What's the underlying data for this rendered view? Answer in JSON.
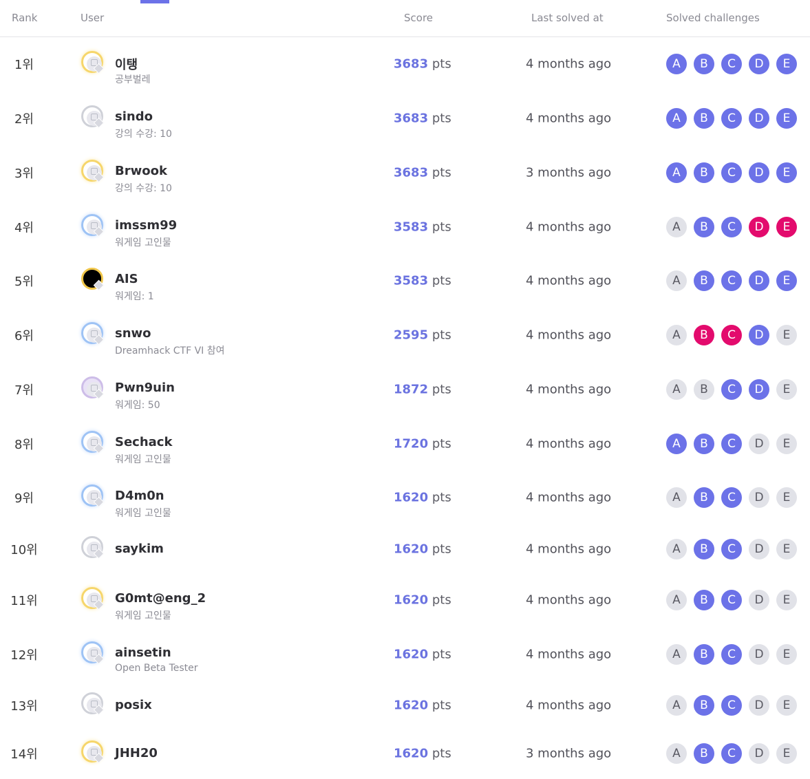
{
  "header": {
    "rank": "Rank",
    "user": "User",
    "score": "Score",
    "last_solved": "Last solved at",
    "solved": "Solved challenges"
  },
  "score_unit": "pts",
  "challenge_labels": [
    "A",
    "B",
    "C",
    "D",
    "E"
  ],
  "colors": {
    "accent": "#6c72e8",
    "first_blood": "#e30b6d",
    "unsolved": "#e1e2e8"
  },
  "rows": [
    {
      "rank": "1위",
      "name": "이탱",
      "subtitle": "공부벌레",
      "score": "3683",
      "last": "4 months ago",
      "avatar": "gold",
      "states": [
        "solved",
        "solved",
        "solved",
        "solved",
        "solved"
      ]
    },
    {
      "rank": "2위",
      "name": "sindo",
      "subtitle": "강의 수강: 10",
      "score": "3683",
      "last": "4 months ago",
      "avatar": "grey",
      "states": [
        "solved",
        "solved",
        "solved",
        "solved",
        "solved"
      ]
    },
    {
      "rank": "3위",
      "name": "Brwook",
      "subtitle": "강의 수강: 10",
      "score": "3683",
      "last": "3 months ago",
      "avatar": "gold",
      "states": [
        "solved",
        "solved",
        "solved",
        "solved",
        "solved"
      ]
    },
    {
      "rank": "4위",
      "name": "imssm99",
      "subtitle": "워게임 고인물",
      "score": "3583",
      "last": "4 months ago",
      "avatar": "blue",
      "states": [
        "unsolved",
        "solved",
        "solved",
        "first",
        "first"
      ]
    },
    {
      "rank": "5위",
      "name": "AIS",
      "subtitle": "워게임: 1",
      "score": "3583",
      "last": "4 months ago",
      "avatar": "black",
      "states": [
        "unsolved",
        "solved",
        "solved",
        "solved",
        "solved"
      ]
    },
    {
      "rank": "6위",
      "name": "snwo",
      "subtitle": "Dreamhack CTF VI 참여",
      "score": "2595",
      "last": "4 months ago",
      "avatar": "blue",
      "states": [
        "unsolved",
        "first",
        "first",
        "solved",
        "unsolved"
      ]
    },
    {
      "rank": "7위",
      "name": "Pwn9uin",
      "subtitle": "워게임: 50",
      "score": "1872",
      "last": "4 months ago",
      "avatar": "purple",
      "states": [
        "unsolved",
        "unsolved",
        "solved",
        "solved",
        "unsolved"
      ]
    },
    {
      "rank": "8위",
      "name": "Sechack",
      "subtitle": "워게임 고인물",
      "score": "1720",
      "last": "4 months ago",
      "avatar": "blue",
      "states": [
        "solved",
        "solved",
        "solved",
        "unsolved",
        "unsolved"
      ]
    },
    {
      "rank": "9위",
      "name": "D4m0n",
      "subtitle": "워게임 고인물",
      "score": "1620",
      "last": "4 months ago",
      "avatar": "blue",
      "states": [
        "unsolved",
        "solved",
        "solved",
        "unsolved",
        "unsolved"
      ]
    },
    {
      "rank": "10위",
      "name": "saykim",
      "subtitle": "",
      "score": "1620",
      "last": "4 months ago",
      "avatar": "grey",
      "states": [
        "unsolved",
        "solved",
        "solved",
        "unsolved",
        "unsolved"
      ]
    },
    {
      "rank": "11위",
      "name": "G0mt@eng_2",
      "subtitle": "워게임 고인물",
      "score": "1620",
      "last": "4 months ago",
      "avatar": "gold",
      "states": [
        "unsolved",
        "solved",
        "solved",
        "unsolved",
        "unsolved"
      ]
    },
    {
      "rank": "12위",
      "name": "ainsetin",
      "subtitle": "Open Beta Tester",
      "score": "1620",
      "last": "4 months ago",
      "avatar": "blue",
      "states": [
        "unsolved",
        "solved",
        "solved",
        "unsolved",
        "unsolved"
      ]
    },
    {
      "rank": "13위",
      "name": "posix",
      "subtitle": "",
      "score": "1620",
      "last": "4 months ago",
      "avatar": "grey",
      "states": [
        "unsolved",
        "solved",
        "solved",
        "unsolved",
        "unsolved"
      ]
    },
    {
      "rank": "14위",
      "name": "JHH20",
      "subtitle": "",
      "score": "1620",
      "last": "3 months ago",
      "avatar": "gold",
      "states": [
        "unsolved",
        "solved",
        "solved",
        "unsolved",
        "unsolved"
      ]
    }
  ]
}
